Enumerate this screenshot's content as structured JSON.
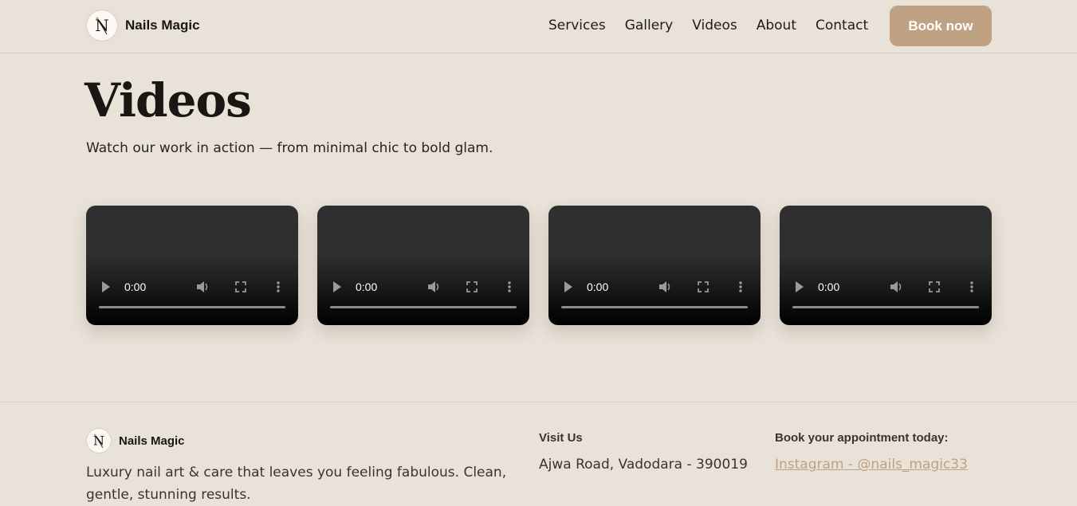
{
  "brand": {
    "name": "Nails Magic",
    "logo_letter": "N"
  },
  "nav": {
    "items": [
      "Services",
      "Gallery",
      "Videos",
      "About",
      "Contact"
    ],
    "book_label": "Book now"
  },
  "main": {
    "title": "Videos",
    "subtitle": "Watch our work in action — from minimal chic to bold glam.",
    "videos": [
      {
        "time": "0:00",
        "progress": 0
      },
      {
        "time": "0:00",
        "progress": 0
      },
      {
        "time": "0:00",
        "progress": 0
      },
      {
        "time": "0:00",
        "progress": 0
      }
    ]
  },
  "footer": {
    "brand_name": "Nails Magic",
    "tagline": "Luxury nail art & care that leaves you feeling fabulous. Clean, gentle, stunning results.",
    "visit_heading": "Visit Us",
    "address": "Ajwa Road, Vadodara - 390019",
    "book_heading": "Book your appointment today:",
    "instagram_label": "Instagram - @nails_magic33"
  },
  "colors": {
    "background": "#e9e2d8",
    "accent": "#bfa184",
    "text": "#1f1b17"
  },
  "icons": [
    "play-icon",
    "volume-icon",
    "fullscreen-icon",
    "more-options-icon"
  ]
}
